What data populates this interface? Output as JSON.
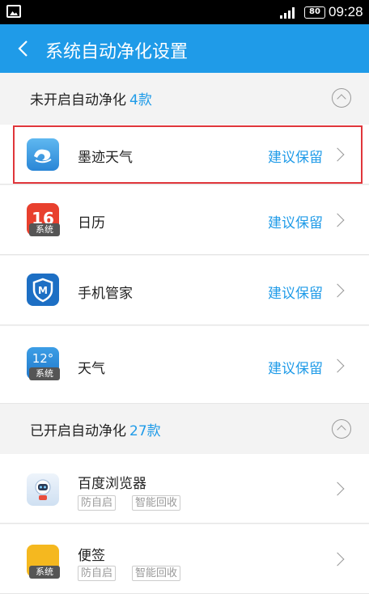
{
  "status_bar": {
    "battery": "80",
    "time": "09:28"
  },
  "header": {
    "title": "系统自动净化设置"
  },
  "sections": [
    {
      "label": "未开启自动净化",
      "count": "4款"
    },
    {
      "label": "已开启自动净化",
      "count": "27款"
    }
  ],
  "disabled_apps": [
    {
      "name": "墨迹天气",
      "status": "建议保留",
      "icon": "moji-weather-icon"
    },
    {
      "name": "日历",
      "status": "建议保留",
      "icon": "calendar-icon",
      "badge": "系统",
      "icon_text": "16"
    },
    {
      "name": "手机管家",
      "status": "建议保留",
      "icon": "phone-manager-icon"
    },
    {
      "name": "天气",
      "status": "建议保留",
      "icon": "weather-icon",
      "badge": "系统",
      "icon_text": "12°"
    }
  ],
  "enabled_apps": [
    {
      "name": "百度浏览器",
      "tags": [
        "防自启",
        "智能回收"
      ],
      "icon": "baidu-browser-icon"
    },
    {
      "name": "便签",
      "tags": [
        "防自启",
        "智能回收"
      ],
      "icon": "notes-icon",
      "badge": "系统"
    }
  ],
  "colors": {
    "accent": "#1f9be8",
    "status_bar": "#000000",
    "highlight": "#e0363b"
  }
}
